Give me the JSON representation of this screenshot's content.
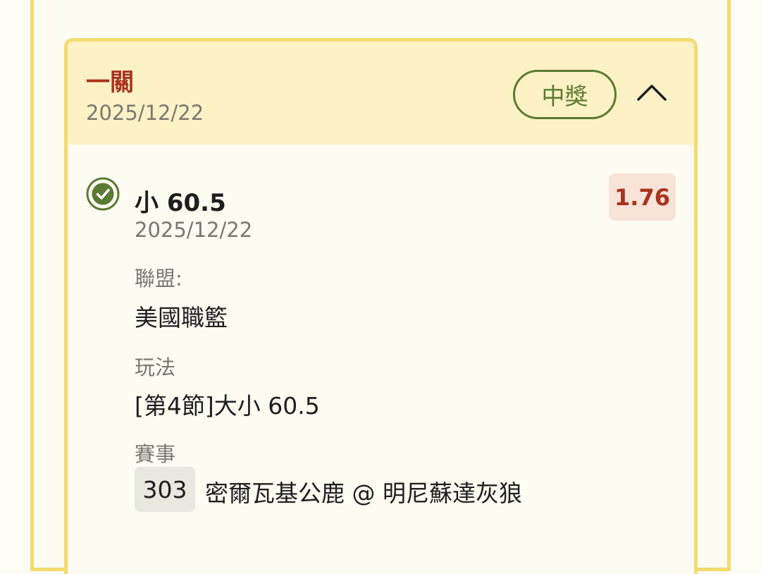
{
  "ticket": {
    "bet_type": "一關",
    "date": "2025/12/22",
    "status": "中獎",
    "collapse_icon": "chevron-up-icon",
    "colors": {
      "frame": "#f2dc6e",
      "header_bg": "#fcf2c6",
      "accent_red": "#a8331f",
      "win_green": "#5b7a33",
      "odds_bg": "#f7e3d8"
    }
  },
  "selection": {
    "result_icon": "check-circle-icon",
    "title": "小 60.5",
    "date": "2025/12/22",
    "odds": "1.76",
    "league_label": "聯盟:",
    "league": "美國職籃",
    "market_label": "玩法",
    "market": "[第4節]大小 60.5",
    "event_label": "賽事",
    "event_number": "303",
    "event_name": "密爾瓦基公鹿 @ 明尼蘇達灰狼"
  }
}
